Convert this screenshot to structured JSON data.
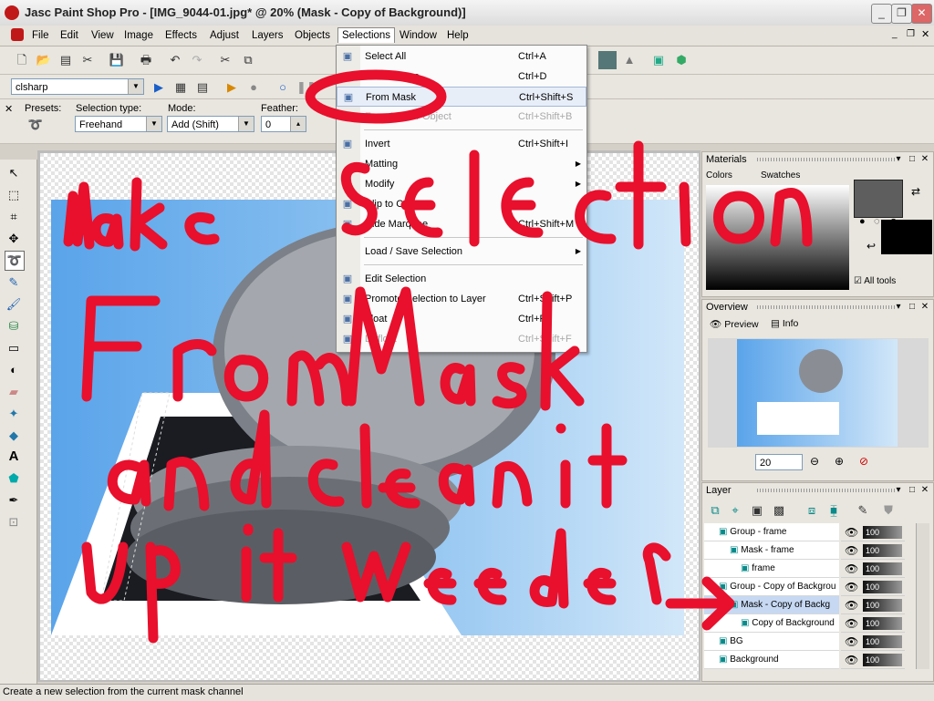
{
  "app": {
    "title": "Jasc Paint Shop Pro - [IMG_9044-01.jpg* @  20% (Mask - Copy of Background)]"
  },
  "window_buttons": [
    "_",
    "❐",
    "✕"
  ],
  "menu": [
    "File",
    "Edit",
    "View",
    "Image",
    "Effects",
    "Adjust",
    "Layers",
    "Objects",
    "Selections",
    "Window",
    "Help"
  ],
  "script_combo": {
    "value": "clsharp"
  },
  "tool_options": {
    "presets_label": "Presets:",
    "selection_type_label": "Selection type:",
    "selection_type_value": "Freehand",
    "mode_label": "Mode:",
    "mode_value": "Add (Shift)",
    "feather_label": "Feather:",
    "feather_value": "0"
  },
  "selections_menu": [
    {
      "label": "Select All",
      "shortcut": "Ctrl+A",
      "icon": "select-all-icon"
    },
    {
      "label": "Select None",
      "shortcut": "Ctrl+D",
      "icon": "select-none-icon"
    },
    {
      "label": "From Mask",
      "shortcut": "Ctrl+Shift+S",
      "icon": "from-mask-icon",
      "highlighted": true
    },
    {
      "label": "From Vector Object",
      "shortcut": "Ctrl+Shift+B",
      "icon": "from-vector-icon",
      "disabled": true
    },
    {
      "label": "Invert",
      "shortcut": "Ctrl+Shift+I",
      "icon": "invert-icon"
    },
    {
      "label": "Matting",
      "submenu": true
    },
    {
      "label": "Modify",
      "submenu": true
    },
    {
      "label": "Clip to Canvas",
      "icon": "clip-canvas-icon"
    },
    {
      "label": "Hide Marquee",
      "shortcut": "Ctrl+Shift+M",
      "icon": "hide-marquee-icon"
    },
    {
      "label": "Load / Save Selection",
      "submenu": true
    },
    {
      "label": "Edit Selection",
      "icon": "edit-selection-icon"
    },
    {
      "label": "Promote Selection to Layer",
      "shortcut": "Ctrl+Shift+P",
      "icon": "promote-icon"
    },
    {
      "label": "Float",
      "shortcut": "Ctrl+F",
      "icon": "float-icon"
    },
    {
      "label": "Defloat",
      "shortcut": "Ctrl+Shift+F",
      "icon": "defloat-icon",
      "disabled": true
    }
  ],
  "materials": {
    "title": "Materials",
    "tab_colors": "Colors",
    "tab_swatches": "Swatches",
    "all_tools": "All tools"
  },
  "overview": {
    "title": "Overview",
    "tab_preview": "Preview",
    "tab_info": "Info",
    "zoom": "20"
  },
  "layers": {
    "title": "Layer",
    "rows": [
      {
        "name": "Group - frame",
        "indent": 1,
        "opacity": "100"
      },
      {
        "name": "Mask - frame",
        "indent": 2,
        "opacity": "100"
      },
      {
        "name": "frame",
        "indent": 3,
        "opacity": "100"
      },
      {
        "name": "Group - Copy of Backgrou",
        "indent": 1,
        "opacity": "100"
      },
      {
        "name": "Mask - Copy of Backg",
        "indent": 2,
        "opacity": "100",
        "selected": true
      },
      {
        "name": "Copy of Background",
        "indent": 3,
        "opacity": "100"
      },
      {
        "name": "BG",
        "indent": 1,
        "opacity": "100"
      },
      {
        "name": "Background",
        "indent": 1,
        "opacity": "100"
      }
    ]
  },
  "annotation": {
    "lines": [
      "make selection",
      "From mask",
      "and clean it",
      "up if needed"
    ],
    "color": "#e8102c"
  },
  "status": {
    "text": "Create a new selection from the current mask channel"
  }
}
